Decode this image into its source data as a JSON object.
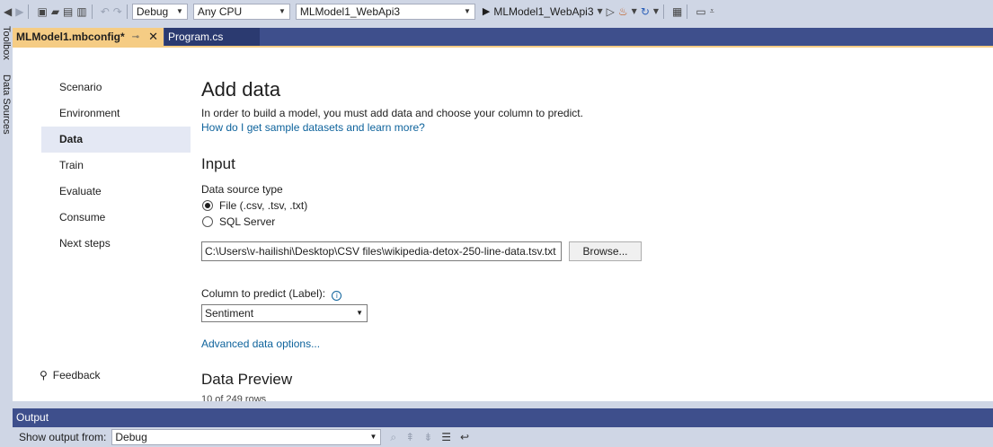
{
  "toolbar": {
    "config": "Debug",
    "platform": "Any CPU",
    "project": "MLModel1_WebApi3",
    "run_target": "MLModel1_WebApi3"
  },
  "side_strip": {
    "toolbox": "Toolbox",
    "data_sources": "Data Sources"
  },
  "tabs": [
    {
      "label": "MLModel1.mbconfig*"
    },
    {
      "label": "Program.cs"
    }
  ],
  "nav": {
    "items": [
      {
        "label": "Scenario"
      },
      {
        "label": "Environment"
      },
      {
        "label": "Data"
      },
      {
        "label": "Train"
      },
      {
        "label": "Evaluate"
      },
      {
        "label": "Consume"
      },
      {
        "label": "Next steps"
      }
    ],
    "selected": "Data",
    "feedback": "Feedback"
  },
  "main": {
    "title": "Add data",
    "description": "In order to build a model, you must add data and choose your column to predict.",
    "help_link": "How do I get sample datasets and learn more?",
    "input_heading": "Input",
    "data_source_type_label": "Data source type",
    "radio_file": "File (.csv, .tsv, .txt)",
    "radio_sql": "SQL Server",
    "file_path": "C:\\Users\\v-hailishi\\Desktop\\CSV files\\wikipedia-detox-250-line-data.tsv.txt",
    "browse_label": "Browse...",
    "column_label": "Column to predict (Label):",
    "column_value": "Sentiment",
    "advanced_link": "Advanced data options...",
    "preview_heading": "Data Preview",
    "row_count": "10 of 249 rows"
  },
  "output": {
    "title": "Output",
    "show_from_label": "Show output from:",
    "show_from_value": "Debug"
  }
}
